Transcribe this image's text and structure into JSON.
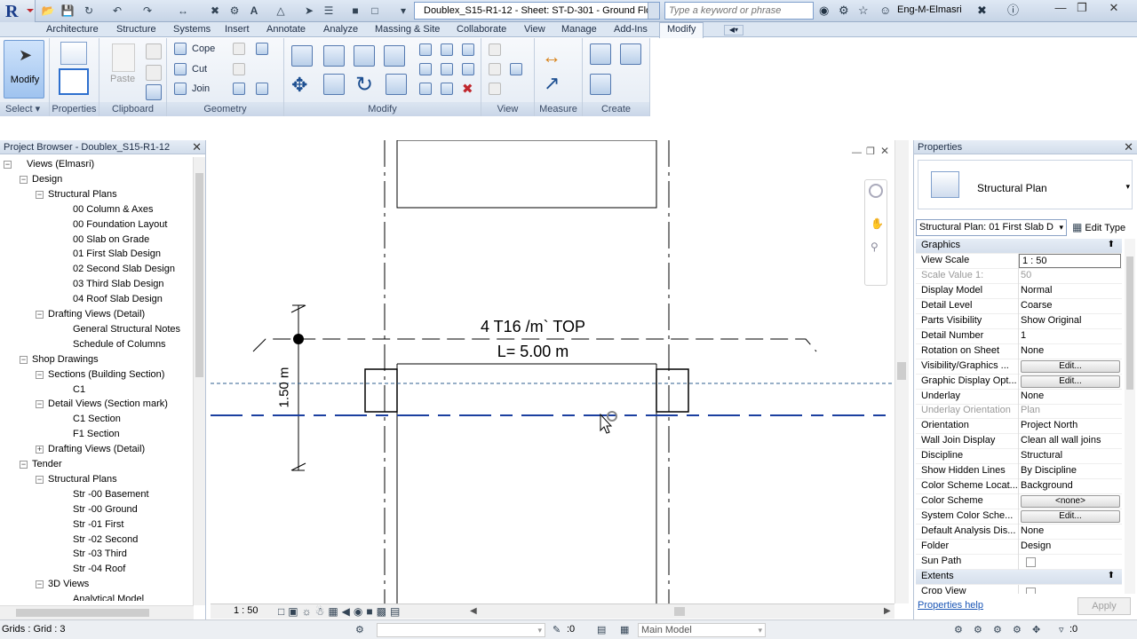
{
  "titlebar": {
    "document_title": "Doublex_S15-R1-12 - Sheet: ST-D-301 - Ground Flo...",
    "search_placeholder": "Type a keyword or phrase",
    "user": "Eng-M-Elmasri"
  },
  "tabs": [
    "Architecture",
    "Structure",
    "Systems",
    "Insert",
    "Annotate",
    "Analyze",
    "Massing & Site",
    "Collaborate",
    "View",
    "Manage",
    "Add-Ins",
    "Modify"
  ],
  "active_tab": "Modify",
  "ribbon": {
    "modify_label": "Modify",
    "select_label": "Select",
    "properties_label": "Properties",
    "paste_label": "Paste",
    "clipboard_label": "Clipboard",
    "cope_label": "Cope",
    "cut_label": "Cut",
    "join_label": "Join",
    "geometry_label": "Geometry",
    "modify_panel_label": "Modify",
    "view_label": "View",
    "measure_label": "Measure",
    "create_label": "Create"
  },
  "project_browser": {
    "title": "Project Browser - Doublex_S15-R1-12",
    "items": [
      {
        "label": "Views (Elmasri)",
        "level": 0,
        "toggle": "-"
      },
      {
        "label": "Design",
        "level": 1,
        "toggle": "-"
      },
      {
        "label": "Structural Plans",
        "level": 2,
        "toggle": "-"
      },
      {
        "label": "00 Column & Axes",
        "level": 3,
        "toggle": ""
      },
      {
        "label": "00 Foundation Layout",
        "level": 3,
        "toggle": ""
      },
      {
        "label": "00 Slab on Grade",
        "level": 3,
        "toggle": ""
      },
      {
        "label": "01 First Slab Design",
        "level": 3,
        "toggle": ""
      },
      {
        "label": "02 Second Slab Design",
        "level": 3,
        "toggle": ""
      },
      {
        "label": "03 Third Slab Design",
        "level": 3,
        "toggle": ""
      },
      {
        "label": "04 Roof Slab Design",
        "level": 3,
        "toggle": ""
      },
      {
        "label": "Drafting Views (Detail)",
        "level": 2,
        "toggle": "-"
      },
      {
        "label": "General Structural Notes",
        "level": 3,
        "toggle": ""
      },
      {
        "label": "Schedule of Columns",
        "level": 3,
        "toggle": ""
      },
      {
        "label": "Shop Drawings",
        "level": 1,
        "toggle": "-"
      },
      {
        "label": "Sections (Building Section)",
        "level": 2,
        "toggle": "-"
      },
      {
        "label": "C1",
        "level": 3,
        "toggle": ""
      },
      {
        "label": "Detail Views (Section mark)",
        "level": 2,
        "toggle": "-"
      },
      {
        "label": "C1 Section",
        "level": 3,
        "toggle": ""
      },
      {
        "label": "F1 Section",
        "level": 3,
        "toggle": ""
      },
      {
        "label": "Drafting Views (Detail)",
        "level": 2,
        "toggle": "+"
      },
      {
        "label": "Tender",
        "level": 1,
        "toggle": "-"
      },
      {
        "label": "Structural Plans",
        "level": 2,
        "toggle": "-"
      },
      {
        "label": "Str -00 Basement",
        "level": 3,
        "toggle": ""
      },
      {
        "label": "Str -00 Ground",
        "level": 3,
        "toggle": ""
      },
      {
        "label": "Str -01 First",
        "level": 3,
        "toggle": ""
      },
      {
        "label": "Str -02 Second",
        "level": 3,
        "toggle": ""
      },
      {
        "label": "Str -03 Third",
        "level": 3,
        "toggle": ""
      },
      {
        "label": "Str -04 Roof",
        "level": 3,
        "toggle": ""
      },
      {
        "label": "3D Views",
        "level": 2,
        "toggle": "-"
      },
      {
        "label": "Analytical Model",
        "level": 3,
        "toggle": ""
      }
    ]
  },
  "canvas": {
    "rebar_label": "4 T16 /m` TOP",
    "length_label": "L= 5.00 m",
    "dimension_label": "1.50 m",
    "view_scale": "1 : 50"
  },
  "properties": {
    "title": "Properties",
    "type_name": "Structural Plan",
    "instance_selector": "Structural Plan: 01 First Slab D",
    "edit_type": "Edit Type",
    "rows": [
      {
        "kind": "group",
        "key": "Graphics"
      },
      {
        "kind": "input",
        "key": "View Scale",
        "value": "1 : 50"
      },
      {
        "kind": "disabled",
        "key": "Scale Value    1:",
        "value": "50"
      },
      {
        "kind": "text",
        "key": "Display Model",
        "value": "Normal"
      },
      {
        "kind": "text",
        "key": "Detail Level",
        "value": "Coarse"
      },
      {
        "kind": "text",
        "key": "Parts Visibility",
        "value": "Show Original"
      },
      {
        "kind": "text",
        "key": "Detail Number",
        "value": "1"
      },
      {
        "kind": "text",
        "key": "Rotation on Sheet",
        "value": "None"
      },
      {
        "kind": "button",
        "key": "Visibility/Graphics ...",
        "value": "Edit..."
      },
      {
        "kind": "button",
        "key": "Graphic Display Opt...",
        "value": "Edit..."
      },
      {
        "kind": "text",
        "key": "Underlay",
        "value": "None"
      },
      {
        "kind": "disabled",
        "key": "Underlay Orientation",
        "value": "Plan"
      },
      {
        "kind": "text",
        "key": "Orientation",
        "value": "Project North"
      },
      {
        "kind": "text",
        "key": "Wall Join Display",
        "value": "Clean all wall joins"
      },
      {
        "kind": "text",
        "key": "Discipline",
        "value": "Structural"
      },
      {
        "kind": "text",
        "key": "Show Hidden Lines",
        "value": "By Discipline"
      },
      {
        "kind": "text",
        "key": "Color Scheme Locat...",
        "value": "Background"
      },
      {
        "kind": "button",
        "key": "Color Scheme",
        "value": "<none>"
      },
      {
        "kind": "button",
        "key": "System Color Sche...",
        "value": "Edit..."
      },
      {
        "kind": "text",
        "key": "Default Analysis Dis...",
        "value": "None"
      },
      {
        "kind": "text",
        "key": "Folder",
        "value": "Design"
      },
      {
        "kind": "check",
        "key": "Sun Path",
        "value": ""
      },
      {
        "kind": "group",
        "key": "Extents"
      },
      {
        "kind": "check",
        "key": "Crop View",
        "value": ""
      }
    ],
    "help_link": "Properties help",
    "apply": "Apply"
  },
  "statusbar": {
    "text": "Grids : Grid : 3",
    "filter_count": ":0",
    "workset_count": ":0",
    "model": "Main Model"
  }
}
